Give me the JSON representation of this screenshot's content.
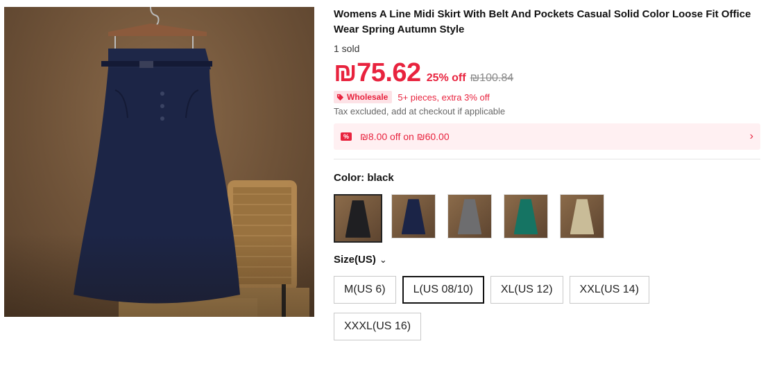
{
  "product": {
    "title": "Womens A Line Midi Skirt With Belt And Pockets Casual Solid Color Loose Fit Office Wear Spring Autumn Style",
    "sold": "1 sold",
    "price": "₪75.62",
    "discount": "25% off",
    "original_price": "₪100.84",
    "wholesale_badge": "Wholesale",
    "wholesale_text": "5+ pieces, extra 3% off",
    "tax_note": "Tax excluded, add at checkout if applicable",
    "coupon_icon": "%",
    "coupon_text": "₪8.00 off on ₪60.00",
    "coupon_chevron": "›",
    "color_label": "Color: black",
    "size_label": "Size(US)",
    "size_chevron": "⌄"
  },
  "colors": [
    {
      "name": "black",
      "hex": "#1f1f22",
      "selected": true
    },
    {
      "name": "navy",
      "hex": "#1b2447",
      "selected": false
    },
    {
      "name": "gray",
      "hex": "#6d6d6f",
      "selected": false
    },
    {
      "name": "green",
      "hex": "#157463",
      "selected": false
    },
    {
      "name": "khaki",
      "hex": "#c9bc98",
      "selected": false
    }
  ],
  "sizes": [
    {
      "label": "M(US 6)",
      "selected": false
    },
    {
      "label": "L(US 08/10)",
      "selected": true
    },
    {
      "label": "XL(US 12)",
      "selected": false
    },
    {
      "label": "XXL(US 14)",
      "selected": false
    },
    {
      "label": "XXXL(US 16)",
      "selected": false
    }
  ],
  "theme": {
    "accent": "#e8233e",
    "coupon_bg": "#fff0f2",
    "skirt": "#1c2546"
  }
}
